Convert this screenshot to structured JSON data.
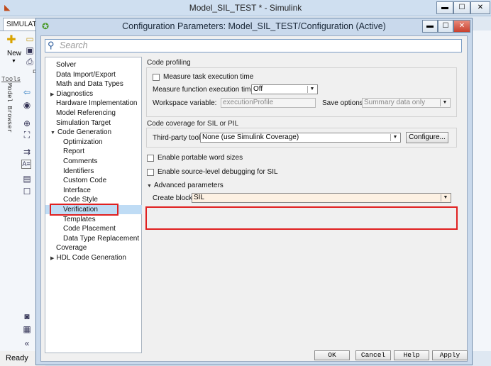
{
  "outer": {
    "title": "Model_SIL_TEST * - Simulink",
    "tab": "SIMULAT",
    "new_label": "New",
    "status": "Ready",
    "sidebar_tools_label": "Tools",
    "model_browser_label": "Model Browser",
    "f_label": "F"
  },
  "dialog": {
    "title": "Configuration Parameters: Model_SIL_TEST/Configuration (Active)",
    "search_placeholder": "Search"
  },
  "tree": [
    {
      "label": "Solver",
      "expand": ""
    },
    {
      "label": "Data Import/Export",
      "expand": ""
    },
    {
      "label": "Math and Data Types",
      "expand": ""
    },
    {
      "label": "Diagnostics",
      "expand": "▶"
    },
    {
      "label": "Hardware Implementation",
      "expand": ""
    },
    {
      "label": "Model Referencing",
      "expand": ""
    },
    {
      "label": "Simulation Target",
      "expand": ""
    },
    {
      "label": "Code Generation",
      "expand": "▼"
    },
    {
      "label": "Optimization",
      "expand": ""
    },
    {
      "label": "Report",
      "expand": ""
    },
    {
      "label": "Comments",
      "expand": ""
    },
    {
      "label": "Identifiers",
      "expand": ""
    },
    {
      "label": "Custom Code",
      "expand": ""
    },
    {
      "label": "Interface",
      "expand": ""
    },
    {
      "label": "Code Style",
      "expand": ""
    },
    {
      "label": "Verification",
      "expand": ""
    },
    {
      "label": "Templates",
      "expand": ""
    },
    {
      "label": "Code Placement",
      "expand": ""
    },
    {
      "label": "Data Type Replacement",
      "expand": ""
    },
    {
      "label": "Coverage",
      "expand": ""
    },
    {
      "label": "HDL Code Generation",
      "expand": "▶"
    }
  ],
  "panel": {
    "code_profiling": {
      "header": "Code profiling",
      "measure_task": "Measure task execution time",
      "measure_function_label": "Measure function execution times:",
      "measure_function_value": "Off",
      "workspace_label": "Workspace variable:",
      "workspace_value": "executionProfile",
      "save_options_label": "Save options:",
      "save_options_value": "Summary data only"
    },
    "coverage": {
      "header": "Code coverage for SIL or PIL",
      "third_party_label": "Third-party tool:",
      "third_party_value": "None (use Simulink Coverage)",
      "configure_label": "Configure..."
    },
    "portable_word_sizes": "Enable portable word sizes",
    "source_level_debug": "Enable source-level debugging for SIL",
    "advanced_header": "Advanced parameters",
    "create_block_label": "Create block:",
    "create_block_value": "SIL"
  },
  "buttons": {
    "ok": "OK",
    "cancel": "Cancel",
    "help": "Help",
    "apply": "Apply"
  }
}
